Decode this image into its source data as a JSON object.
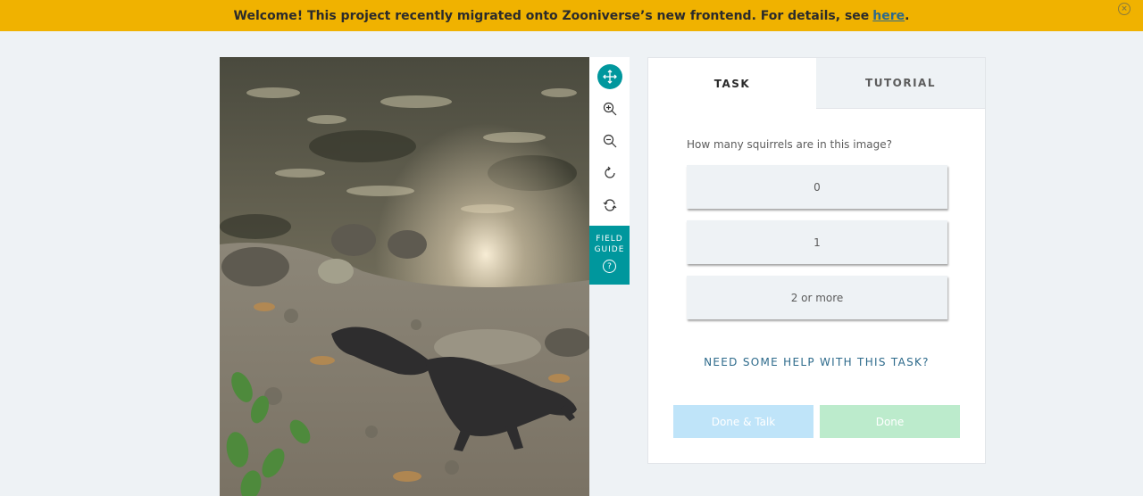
{
  "banner": {
    "message": "Welcome! This project recently migrated onto Zooniverse’s new frontend. For details, see",
    "link_text": "here",
    "suffix": ".",
    "close_symbol": "×"
  },
  "subject": {
    "description": "squirrel-trail-camera-photo"
  },
  "toolbar": {
    "tools": [
      "move-icon",
      "zoom-in-icon",
      "zoom-out-icon",
      "rotate-icon",
      "reset-icon"
    ],
    "field_guide_label_1": "FIELD",
    "field_guide_label_2": "GUIDE",
    "field_guide_help": "?"
  },
  "panel": {
    "tabs": [
      {
        "label": "TASK",
        "active": true
      },
      {
        "label": "TUTORIAL",
        "active": false
      }
    ],
    "question": "How many squirrels are in this image?",
    "answers": [
      "0",
      "1",
      "2 or more"
    ],
    "help_link": "NEED SOME HELP WITH THIS TASK?",
    "done_talk_label": "Done & Talk",
    "done_label": "Done"
  },
  "colors": {
    "banner": "#f0b200",
    "teal": "#00979d",
    "link": "#2d6a8b",
    "done_talk": "#bfe4f9",
    "done": "#bcebcc"
  }
}
